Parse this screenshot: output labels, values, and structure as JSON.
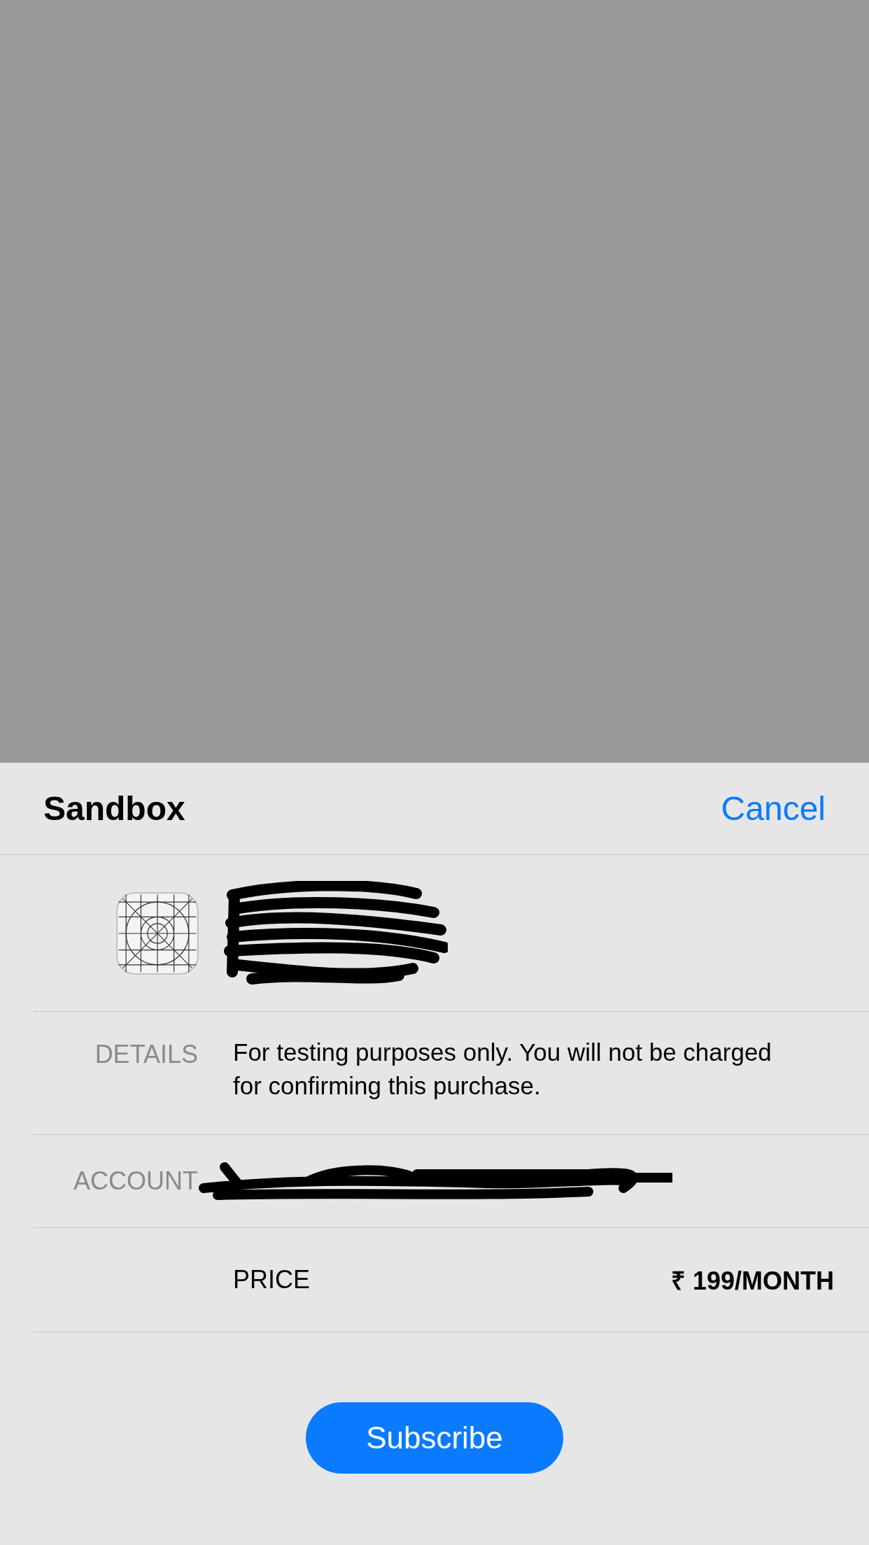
{
  "sheet": {
    "title": "Sandbox",
    "cancel": "Cancel"
  },
  "rows": [
    {
      "kind": "app"
    },
    {
      "kind": "details",
      "label": "DETAILS",
      "value": "For testing purposes only. You will not be charged for confirming this purchase."
    },
    {
      "kind": "account",
      "label": "ACCOUNT"
    },
    {
      "kind": "price",
      "label": "PRICE",
      "value": "₹ 199/MONTH"
    }
  ],
  "button": "Subscribe"
}
